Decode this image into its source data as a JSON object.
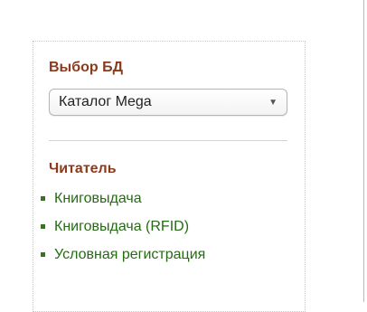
{
  "db_section": {
    "title": "Выбор БД",
    "select_value": "Каталог Mega",
    "select_icon": "chevron-down-icon"
  },
  "reader_section": {
    "title": "Читатель",
    "items": [
      {
        "label": "Книговыдача"
      },
      {
        "label": "Книговыдача (RFID)"
      },
      {
        "label": "Условная регистрация"
      }
    ]
  },
  "colors": {
    "heading": "#8b3a1d",
    "link": "#246b12",
    "bullet": "#2d7a16"
  }
}
